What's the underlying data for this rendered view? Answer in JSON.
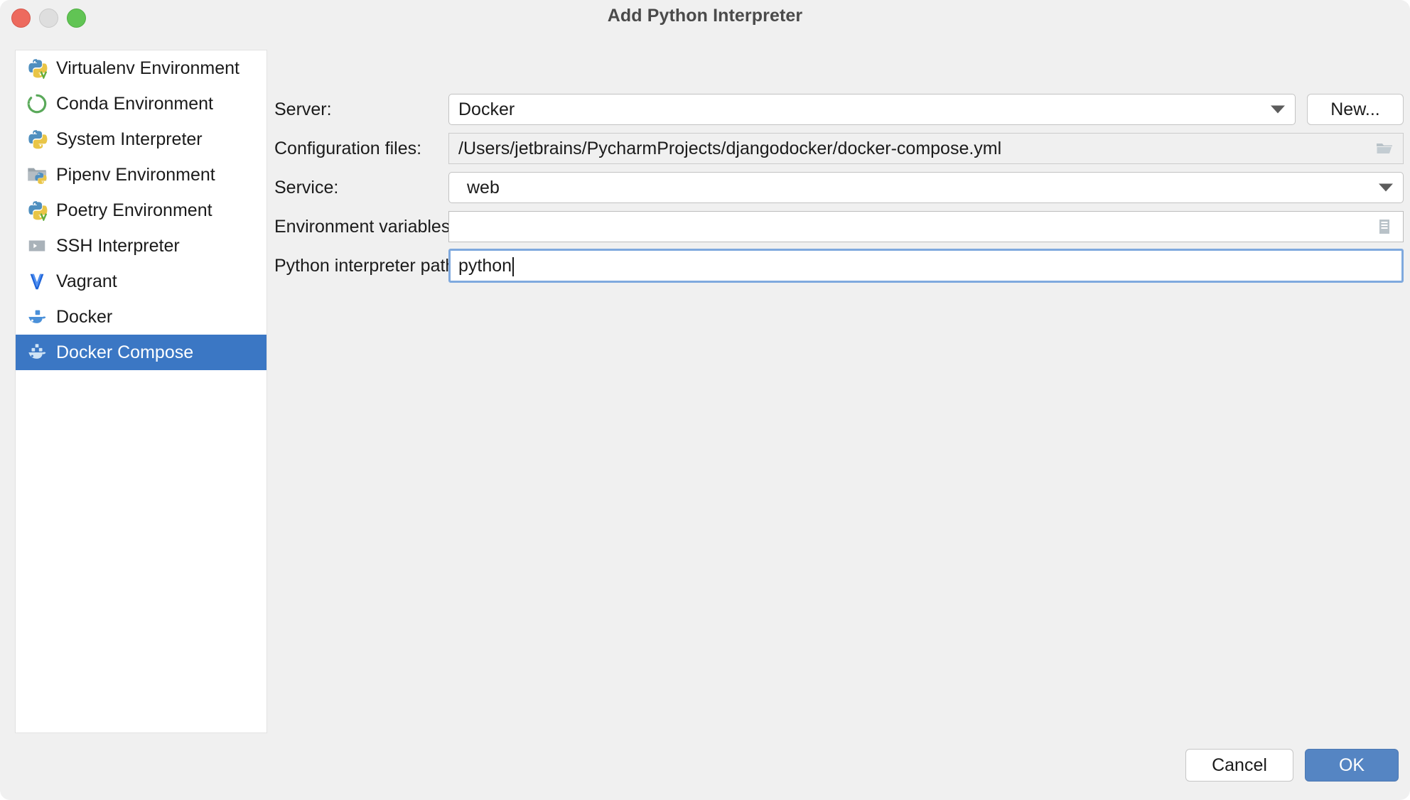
{
  "window": {
    "title": "Add Python Interpreter",
    "traffic_lights": [
      {
        "name": "close",
        "color": "#ed6a5e"
      },
      {
        "name": "minimize",
        "color": "#dedede"
      },
      {
        "name": "zoom",
        "color": "#61c454"
      }
    ]
  },
  "sidebar": {
    "selected_index": 8,
    "items": [
      {
        "label": "Virtualenv Environment",
        "icon": "python-venv-icon"
      },
      {
        "label": "Conda Environment",
        "icon": "conda-icon"
      },
      {
        "label": "System Interpreter",
        "icon": "python-icon"
      },
      {
        "label": "Pipenv Environment",
        "icon": "pipenv-folder-icon"
      },
      {
        "label": "Poetry Environment",
        "icon": "python-venv-icon"
      },
      {
        "label": "SSH Interpreter",
        "icon": "ssh-terminal-icon"
      },
      {
        "label": "Vagrant",
        "icon": "vagrant-icon"
      },
      {
        "label": "Docker",
        "icon": "docker-icon"
      },
      {
        "label": "Docker Compose",
        "icon": "docker-compose-icon"
      }
    ]
  },
  "form": {
    "server": {
      "label": "Server:",
      "value": "Docker",
      "placeholder": "",
      "dropdown_icon": "chevron-down-icon"
    },
    "new_button": {
      "label": "New..."
    },
    "configuration_files": {
      "label": "Configuration files:",
      "value": "/Users/jetbrains/PycharmProjects/djangodocker/docker-compose.yml",
      "browse_icon": "open-folder-icon"
    },
    "service": {
      "label": "Service:",
      "value": "web",
      "dropdown_icon": "chevron-down-icon"
    },
    "environment_variables": {
      "label": "Environment variables:",
      "value": "",
      "placeholder": "",
      "editor_icon": "edit-list-icon"
    },
    "python_interpreter_path": {
      "label": "Python interpreter path:",
      "value": "python",
      "placeholder": "",
      "focused": true
    }
  },
  "footer": {
    "cancel_label": "Cancel",
    "ok_label": "OK"
  },
  "colors": {
    "selection_blue": "#3b77c4",
    "primary_button": "#5585c3",
    "focus_ring": "#7fa9de",
    "window_bg": "#f0f0f0",
    "panel_bg": "#ffffff"
  }
}
